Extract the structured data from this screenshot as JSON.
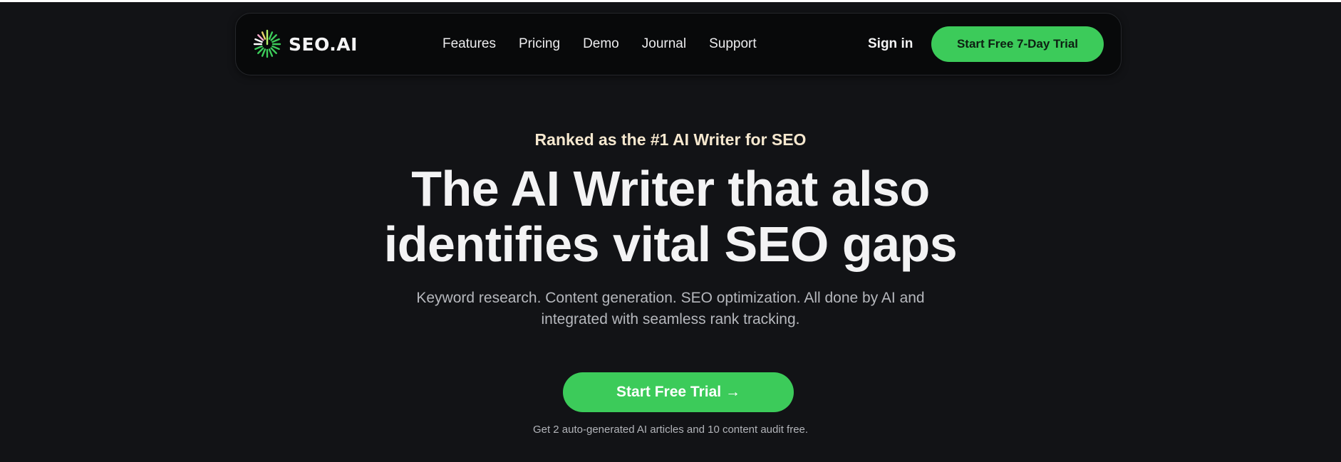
{
  "brand": {
    "name": "SEO.AI",
    "accent": "#3ccb5a",
    "background": "#121316",
    "nav_background": "#08090a",
    "eyebrow_color": "#f6e8cf"
  },
  "nav": {
    "links": [
      {
        "label": "Features"
      },
      {
        "label": "Pricing"
      },
      {
        "label": "Demo"
      },
      {
        "label": "Journal"
      },
      {
        "label": "Support"
      }
    ],
    "signin_label": "Sign in",
    "cta_label": "Start Free 7-Day Trial"
  },
  "hero": {
    "eyebrow": "Ranked as the #1 AI Writer for SEO",
    "headline_line1": "The AI Writer that also",
    "headline_line2": "identifies vital SEO gaps",
    "subtext_line1": "Keyword research. Content generation. SEO optimization. All done by AI and",
    "subtext_line2": "integrated with seamless rank tracking.",
    "cta_label": "Start Free Trial →",
    "footnote": "Get 2 auto-generated AI articles and 10 content audit free."
  }
}
